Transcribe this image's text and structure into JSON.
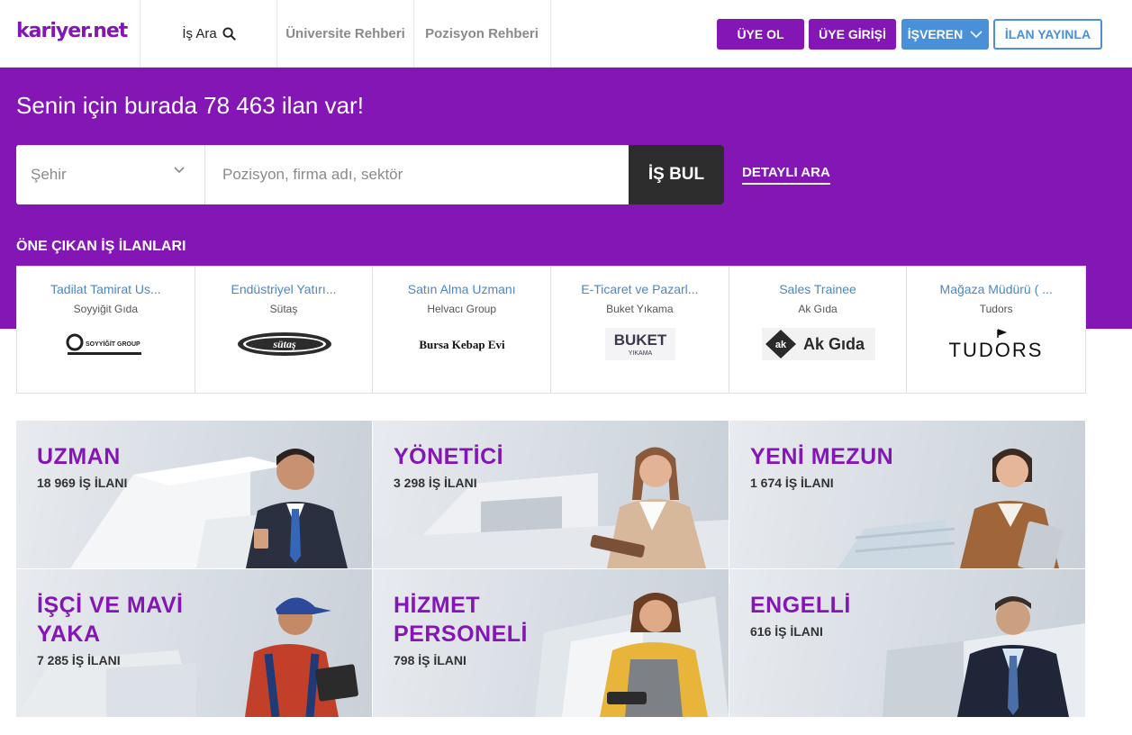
{
  "header": {
    "logo": "kariyer.net",
    "nav": {
      "is_ara": "İş Ara",
      "universite": "Üniversite Rehberi",
      "pozisyon": "Pozisyon Rehberi"
    },
    "buttons": {
      "uye_ol": "ÜYE OL",
      "uye_girisi": "ÜYE GİRİŞİ",
      "isveren": "İŞVEREN",
      "ilan_yayinla": "İLAN YAYINLA"
    }
  },
  "hero": {
    "title": "Senin için burada 78 463 ilan var!",
    "city_placeholder": "Şehir",
    "search_placeholder": "Pozisyon, firma adı, sektör",
    "search_button": "İŞ BUL",
    "advanced_search": "DETAYLI ARA",
    "featured_title": "ÖNE ÇIKAN İŞ İLANLARI"
  },
  "featured_jobs": [
    {
      "title": "Tadilat Tamirat Us...",
      "company": "Soyyiğit Gıda",
      "logo_text": "SOYYİĞİT GROUP"
    },
    {
      "title": "Endüstriyel Yatırı...",
      "company": "Sütaş",
      "logo_text": "sütaş"
    },
    {
      "title": "Satın Alma Uzmanı",
      "company": "Helvacı Group",
      "logo_text": "Bursa Kebap Evi"
    },
    {
      "title": "E-Ticaret ve Pazarl...",
      "company": "Buket Yıkama",
      "logo_text": "BUKET",
      "logo_subtext": "YIKAMA"
    },
    {
      "title": "Sales Trainee",
      "company": "Ak Gıda",
      "logo_text": "Ak Gıda",
      "logo_mark": "ak"
    },
    {
      "title": "Mağaza Müdürü ( ...",
      "company": "Tudors",
      "logo_text": "TUDORS"
    }
  ],
  "categories": [
    {
      "title": "UZMAN",
      "count": "18 969 İŞ İLANI"
    },
    {
      "title": "YÖNETİCİ",
      "count": "3 298 İŞ İLANI"
    },
    {
      "title": "YENİ MEZUN",
      "count": "1 674 İŞ İLANI"
    },
    {
      "title": "İŞÇİ VE MAVİ YAKA",
      "count": "7 285 İŞ İLANI"
    },
    {
      "title": "HİZMET PERSONELİ",
      "count": "798 İŞ İLANI"
    },
    {
      "title": "ENGELLİ",
      "count": "616 İŞ İLANI"
    }
  ],
  "colors": {
    "brand_purple": "#8316b5",
    "accent_blue": "#4a90d9",
    "search_button": "#2d2d2d"
  }
}
